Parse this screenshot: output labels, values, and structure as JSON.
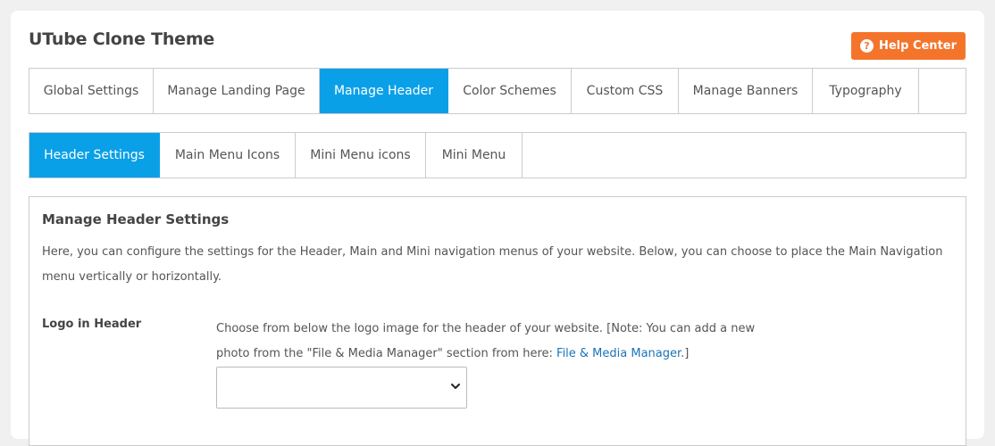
{
  "page": {
    "title": "UTube Clone Theme",
    "help_button": "Help Center"
  },
  "main_tabs": [
    {
      "label": "Global Settings",
      "active": false
    },
    {
      "label": "Manage Landing Page",
      "active": false
    },
    {
      "label": "Manage Header",
      "active": true
    },
    {
      "label": "Color Schemes",
      "active": false
    },
    {
      "label": "Custom CSS",
      "active": false
    },
    {
      "label": "Manage Banners",
      "active": false
    },
    {
      "label": "Typography",
      "active": false
    }
  ],
  "sub_tabs": [
    {
      "label": "Header Settings",
      "active": true
    },
    {
      "label": "Main Menu Icons",
      "active": false
    },
    {
      "label": "Mini Menu icons",
      "active": false
    },
    {
      "label": "Mini Menu",
      "active": false
    }
  ],
  "section": {
    "title": "Manage Header Settings",
    "description": "Here, you can configure the settings for the Header, Main and Mini navigation menus of your website. Below, you can choose to place the Main Navigation menu vertically or horizontally.",
    "logo_field": {
      "label": "Logo in Header",
      "help_text": "Choose from below the logo image for the header of your website. [Note: You can add a new photo from the \"File & Media Manager\" section from here: ",
      "link_text": "File & Media Manager",
      "help_suffix": ".]",
      "selected_value": ""
    }
  },
  "colors": {
    "accent": "#0aa0e8",
    "help_button": "#f4742b",
    "link": "#1a74b8"
  },
  "icons": {
    "help": "question-circle-icon",
    "select": "chevron-down-icon"
  }
}
